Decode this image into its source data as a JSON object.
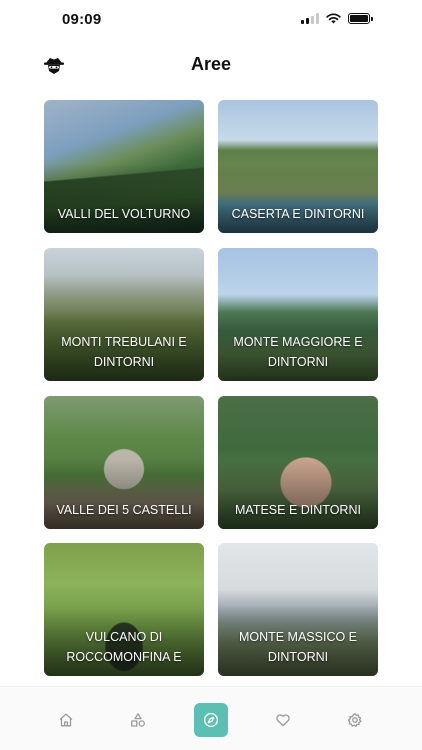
{
  "status_bar": {
    "time": "09:09"
  },
  "header": {
    "title": "Aree",
    "avatar_icon": "detective-hat-icon"
  },
  "areas": [
    {
      "label": "VALLI DEL VOLTURNO"
    },
    {
      "label": "CASERTA E DINTORNI"
    },
    {
      "label": "MONTI TREBULANI E DINTORNI"
    },
    {
      "label": "MONTE MAGGIORE E DINTORNI"
    },
    {
      "label": "VALLE DEI 5 CASTELLI"
    },
    {
      "label": "MATESE E DINTORNI"
    },
    {
      "label": "VULCANO DI ROCCOMONFINA E"
    },
    {
      "label": "MONTE MASSICO E DINTORNI"
    }
  ],
  "tabbar": {
    "active_color": "#5bbfb3",
    "tabs": [
      {
        "icon": "home-icon"
      },
      {
        "icon": "shapes-icon"
      },
      {
        "icon": "compass-icon",
        "active": true
      },
      {
        "icon": "heart-icon"
      },
      {
        "icon": "gear-icon"
      }
    ]
  }
}
